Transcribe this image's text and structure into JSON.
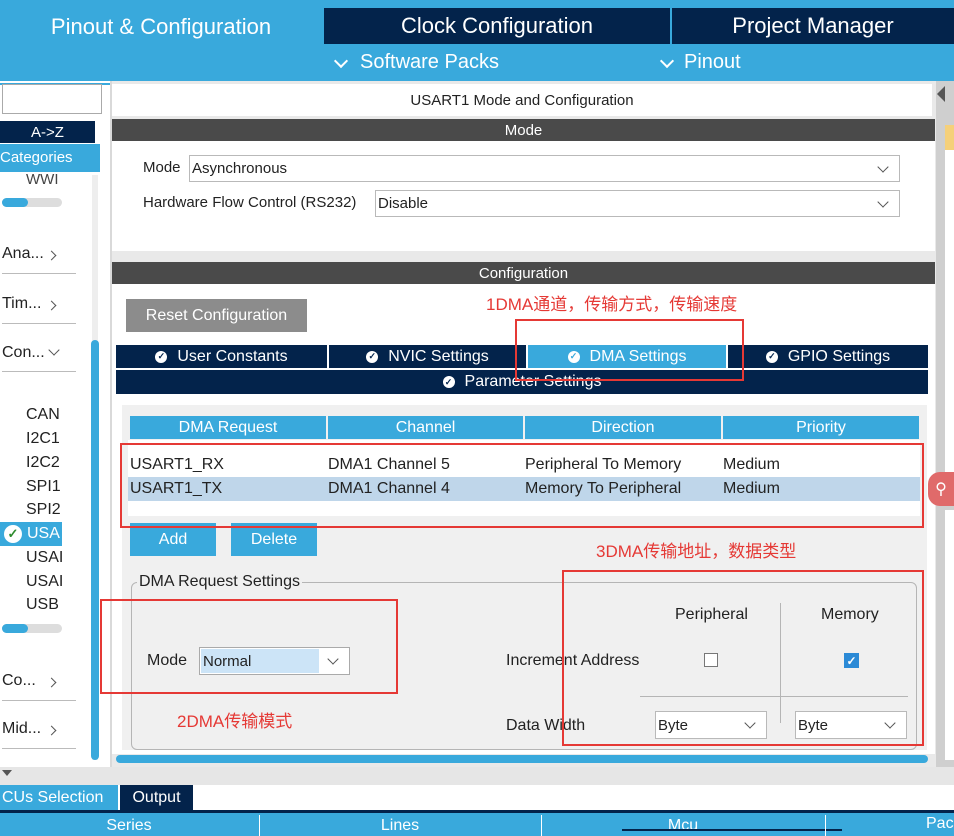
{
  "top_tabs": {
    "pinout": "Pinout & Configuration",
    "clock": "Clock Configuration",
    "project": "Project Manager"
  },
  "sub_menu": {
    "software_packs": "Software Packs",
    "pinout": "Pinout"
  },
  "sidebar": {
    "az_label": "A->Z",
    "categories_label": "Categories",
    "wwi_label": "WWI",
    "groups": [
      {
        "label": "Ana..."
      },
      {
        "label": "Tim..."
      },
      {
        "label": "Con..."
      },
      {
        "label": "Co..."
      },
      {
        "label": "Mid..."
      }
    ],
    "connectivity_items": [
      "CAN",
      "I2C1",
      "I2C2",
      "SPI1",
      "SPI2",
      "USA",
      "USAI",
      "USAI",
      "USB"
    ]
  },
  "panel": {
    "title": "USART1 Mode and Configuration",
    "mode_header": "Mode",
    "mode_label": "Mode",
    "mode_value": "Asynchronous",
    "hwflow_label": "Hardware Flow Control (RS232)",
    "hwflow_value": "Disable",
    "config_header": "Configuration",
    "reset_button": "Reset Configuration",
    "tabs": {
      "user_constants": "User Constants",
      "nvic": "NVIC Settings",
      "dma": "DMA Settings",
      "gpio": "GPIO Settings",
      "parameter": "Parameter Settings"
    }
  },
  "dma_table": {
    "headers": [
      "DMA Request",
      "Channel",
      "Direction",
      "Priority"
    ],
    "rows": [
      [
        "USART1_RX",
        "DMA1 Channel 5",
        "Peripheral To Memory",
        "Medium"
      ],
      [
        "USART1_TX",
        "DMA1 Channel 4",
        "Memory To Peripheral",
        "Medium"
      ]
    ],
    "add_button": "Add",
    "delete_button": "Delete"
  },
  "request_settings": {
    "legend": "DMA Request Settings",
    "mode_label": "Mode",
    "mode_value": "Normal",
    "peripheral_header": "Peripheral",
    "memory_header": "Memory",
    "increment_label": "Increment Address",
    "peripheral_increment": false,
    "memory_increment": true,
    "data_width_label": "Data Width",
    "peripheral_width": "Byte",
    "memory_width": "Byte"
  },
  "annotations": {
    "a1": "1DMA通道，传输方式，传输速度",
    "a2": "2DMA传输模式",
    "a3": "3DMA传输地址，数据类型"
  },
  "bottom": {
    "tab_mcu": "CUs Selection",
    "tab_output": "Output",
    "columns": [
      "Series",
      "Lines",
      "Mcu",
      "Pac"
    ]
  },
  "colors": {
    "navy": "#03234b",
    "accent": "#39a9dc",
    "annotation": "#e53935",
    "dark_header": "#4a4a4a"
  }
}
